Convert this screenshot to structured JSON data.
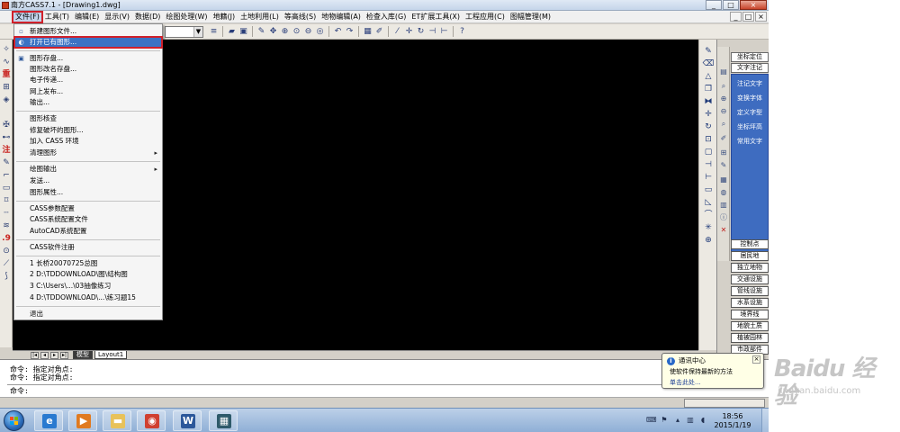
{
  "window": {
    "title": "南方CASS7.1 - [Drawing1.dwg]",
    "buttons": [
      "_",
      "□",
      "×"
    ]
  },
  "menubar": {
    "items": [
      {
        "label": "文件(F)",
        "active": true
      },
      {
        "label": "工具(T)"
      },
      {
        "label": "编辑(E)"
      },
      {
        "label": "显示(V)"
      },
      {
        "label": "数据(D)"
      },
      {
        "label": "绘图处理(W)"
      },
      {
        "label": "地籍(J)"
      },
      {
        "label": "土地利用(L)"
      },
      {
        "label": "等高线(S)"
      },
      {
        "label": "地物编辑(A)"
      },
      {
        "label": "检查入库(G)"
      },
      {
        "label": "ET扩展工具(X)"
      },
      {
        "label": "工程应用(C)"
      },
      {
        "label": "图幅管理(M)"
      }
    ],
    "doc_buttons": [
      "_",
      "□",
      "×"
    ]
  },
  "file_menu": {
    "items": [
      {
        "label": "新建图形文件..."
      },
      {
        "label": "打开已有图形...",
        "highlighted": true
      },
      {
        "label": "图形存盘..."
      },
      {
        "label": "图形改名存盘..."
      },
      {
        "label": "电子传递..."
      },
      {
        "label": "网上发布..."
      },
      {
        "label": "输出..."
      },
      {
        "label": "图形核查"
      },
      {
        "label": "修复破坏的图形..."
      },
      {
        "label": "加入 CASS 环境"
      },
      {
        "label": "清理图形",
        "submenu": true
      },
      {
        "label": "绘图输出",
        "submenu": true
      },
      {
        "label": "发送..."
      },
      {
        "label": "图形属性..."
      },
      {
        "label": "CASS参数配置"
      },
      {
        "label": "CASS系统配置文件"
      },
      {
        "label": "AutoCAD系统配置"
      },
      {
        "label": "CASS软件注册"
      },
      {
        "label": "1 长桥20070725总图"
      },
      {
        "label": "2 D:\\TDDOWNLOAD\\图\\结构图"
      },
      {
        "label": "3 C:\\Users\\...\\03抽像练习"
      },
      {
        "label": "4 D:\\TDDOWNLOAD\\...\\练习题15"
      },
      {
        "label": "退出"
      }
    ],
    "submenu_arrow": "▸"
  },
  "layout_tabs": {
    "model": "模型",
    "layout1": "Layout1"
  },
  "command": {
    "lines": [
      "命令: 指定对角点:",
      "命令: 指定对角点:",
      "命令:"
    ]
  },
  "right_panel": {
    "header_buttons": [
      "坐标定位",
      "文字注记"
    ],
    "blue_items": [
      "注记文字",
      "变换字体",
      "定义字型",
      "坐标坪高",
      "常用文字"
    ],
    "buttons": [
      "控制点",
      "居民地",
      "独立地物",
      "交通设施",
      "管线设施",
      "水系设施",
      "境界线",
      "地貌土质",
      "植被园林",
      "市政部件"
    ]
  },
  "balloon": {
    "title": "通讯中心",
    "body": "使软件保持最新的方法",
    "link": "单击此处..."
  },
  "taskbar": {
    "time": "18:56",
    "date": "2015/1/19"
  },
  "watermark": {
    "logo": "Baidu 经验",
    "sub": "jingyan.baidu.com"
  }
}
